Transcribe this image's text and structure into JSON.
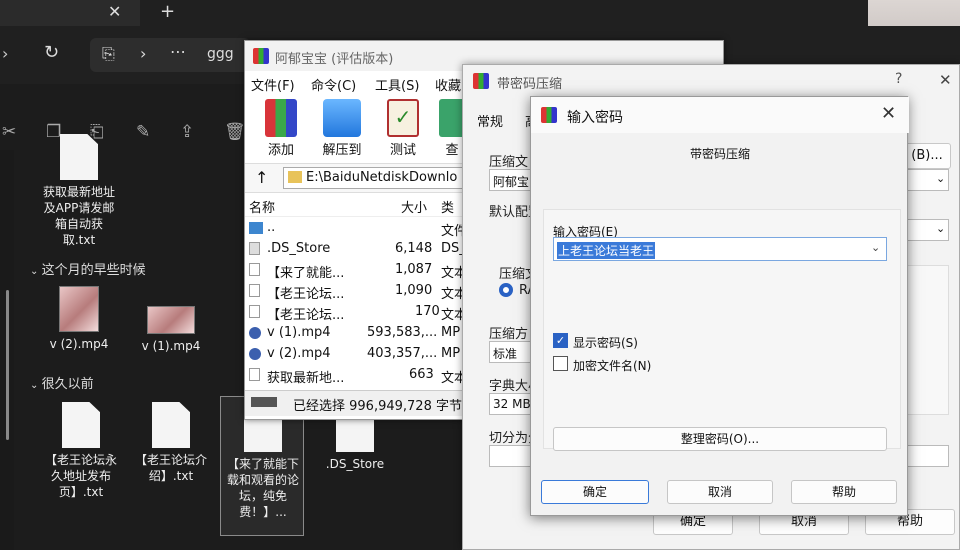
{
  "explorer": {
    "tab_close": "✕",
    "tab_new": "+",
    "address_text": "ggg",
    "nav": {
      "copy": "⎘",
      "chevron": "›",
      "more": "⋯",
      "refresh": "↻"
    },
    "files_top": [
      {
        "name": "获取最新地址及APP请发邮箱自动获取.txt"
      }
    ],
    "group1": "这个月的早些时候",
    "media": [
      {
        "name": "v (2).mp4"
      },
      {
        "name": "v (1).mp4"
      }
    ],
    "group2": "很久以前",
    "files_bottom": [
      {
        "name": "【老王论坛永久地址发布页】.txt"
      },
      {
        "name": "【老王论坛介绍】.txt"
      },
      {
        "name": "【来了就能下载和观看的论坛，纯免费！】..."
      },
      {
        "name": ".DS_Store"
      }
    ]
  },
  "archive": {
    "title": "阿郁宝宝 (评估版本)",
    "menu": [
      "文件(F)",
      "命令(C)",
      "工具(S)",
      "收藏"
    ],
    "tools": [
      {
        "label": "添加",
        "icon": "add-archive-icon"
      },
      {
        "label": "解压到",
        "icon": "extract-folder-icon"
      },
      {
        "label": "测试",
        "icon": "test-check-icon"
      },
      {
        "label": "查",
        "icon": "view-icon"
      }
    ],
    "path": "E:\\BaiduNetdiskDownlo",
    "columns": {
      "name": "名称",
      "size": "大小",
      "type": "类"
    },
    "rows": [
      {
        "name": "..",
        "size": "",
        "type": "文件"
      },
      {
        "name": ".DS_Store",
        "size": "6,148",
        "type": "DS_"
      },
      {
        "name": "【来了就能...",
        "size": "1,087",
        "type": "文本"
      },
      {
        "name": "【老王论坛...",
        "size": "1,090",
        "type": "文本"
      },
      {
        "name": "【老王论坛...",
        "size": "170",
        "type": "文本"
      },
      {
        "name": "v (1).mp4",
        "size": "593,583,...",
        "type": "MP"
      },
      {
        "name": "v (2).mp4",
        "size": "403,357,...",
        "type": "MP"
      },
      {
        "name": "获取最新地...",
        "size": "663",
        "type": "文本"
      }
    ],
    "status": "已经选择 996,949,728 字节"
  },
  "compress_dialog": {
    "title": "带密码压缩",
    "help": "?",
    "close": "✕",
    "tabs": [
      "常规",
      "高"
    ],
    "labels": {
      "archive_name": "压缩文",
      "archive_value": "阿郁宝",
      "browse": "(B)...",
      "default_config": "默认配置",
      "format": "压缩文",
      "format_opt": "RA",
      "method": "压缩方",
      "method_value": "标准",
      "dict": "字典大小",
      "dict_value": "32 MB",
      "split": "切分为分"
    },
    "ok": "确定",
    "cancel": "取消",
    "help_btn": "帮助"
  },
  "password_dialog": {
    "title": "输入密码",
    "close": "✕",
    "subtitle": "带密码压缩",
    "password_label": "输入密码(E)",
    "password_value": "上老王论坛当老王",
    "show_password": "显示密码(S)",
    "show_password_checked": true,
    "encrypt_names": "加密文件名(N)",
    "encrypt_names_checked": false,
    "organize": "整理密码(O)...",
    "ok": "确定",
    "cancel": "取消",
    "help": "帮助"
  }
}
